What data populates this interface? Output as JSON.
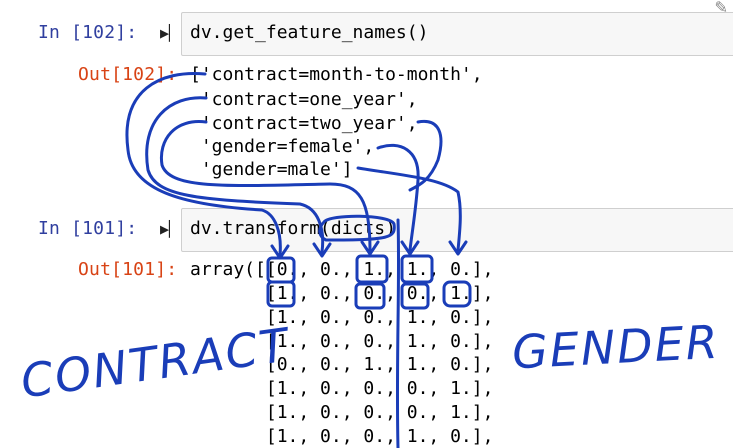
{
  "cells": [
    {
      "in_prompt": "In [102]:",
      "code": "dv.get_feature_names()",
      "out_prompt": "Out[102]:",
      "output_lines": [
        "['contract=month-to-month',",
        " 'contract=one_year',",
        " 'contract=two_year',",
        " 'gender=female',",
        " 'gender=male']"
      ]
    },
    {
      "in_prompt": "In [101]:",
      "code": "dv.transform(dicts)",
      "out_prompt": "Out[101]:",
      "output_lines": [
        "array([[0., 0., 1., 1., 0.],",
        "       [1., 0., 0., 0., 1.],",
        "       [1., 0., 0., 1., 0.],",
        "       [1., 0., 0., 1., 0.],",
        "       [0., 0., 1., 1., 0.],",
        "       [1., 0., 0., 0., 1.],",
        "       [1., 0., 0., 0., 1.],",
        "       [1., 0., 0., 1., 0.],"
      ]
    }
  ],
  "annotations": {
    "contract_label": "CONTRACT",
    "gender_label": "GENDER",
    "ink_color": "#1a3db8"
  },
  "icons": {
    "run": "run-cell-icon",
    "edit": "pencil-icon"
  }
}
